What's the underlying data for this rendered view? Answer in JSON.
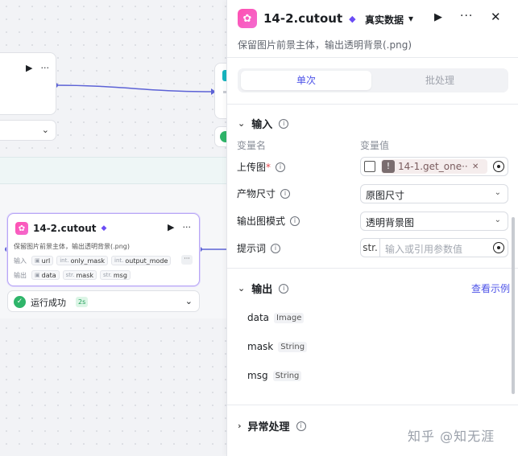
{
  "canvas": {
    "node_main": {
      "title": "14-2.cutout",
      "description": "保留图片前景主体，输出透明背景(.png)",
      "inputs_label": "输入",
      "inputs": [
        {
          "type": "",
          "name": "url"
        },
        {
          "type": "int.",
          "name": "only_mask"
        },
        {
          "type": "int.",
          "name": "output_mode"
        }
      ],
      "outputs_label": "输出",
      "outputs": [
        {
          "type": "",
          "name": "data"
        },
        {
          "type": "str.",
          "name": "mask"
        },
        {
          "type": "str.",
          "name": "msg"
        }
      ],
      "more": "···",
      "status_text": "运行成功",
      "status_time": "2s"
    }
  },
  "panel": {
    "title": "14-2.cutout",
    "mode_label": "真实数据",
    "description": "保留图片前景主体，输出透明背景(.png)",
    "tabs": [
      {
        "label": "单次",
        "active": true
      },
      {
        "label": "批处理",
        "active": false
      }
    ],
    "input_section": {
      "title": "输入",
      "col_name": "变量名",
      "col_value": "变量值",
      "fields": [
        {
          "label": "上传图",
          "required": "*",
          "ref": "14-1.get_one···"
        },
        {
          "label": "产物尺寸",
          "value": "原图尺寸"
        },
        {
          "label": "输出图模式",
          "value": "透明背景图"
        },
        {
          "label": "提示词",
          "prefix": "str.",
          "placeholder": "输入或引用参数值"
        }
      ]
    },
    "output_section": {
      "title": "输出",
      "link": "查看示例",
      "items": [
        {
          "name": "data",
          "type": "Image"
        },
        {
          "name": "mask",
          "type": "String"
        },
        {
          "name": "msg",
          "type": "String"
        }
      ]
    },
    "exception_section": {
      "title": "异常处理"
    }
  },
  "watermark": "知乎 @知无涯",
  "colors": {
    "accent": "#4d53e8",
    "success": "#2fb56a",
    "brand_pink": "#ff4fb0",
    "edge": "#5c62d6"
  }
}
